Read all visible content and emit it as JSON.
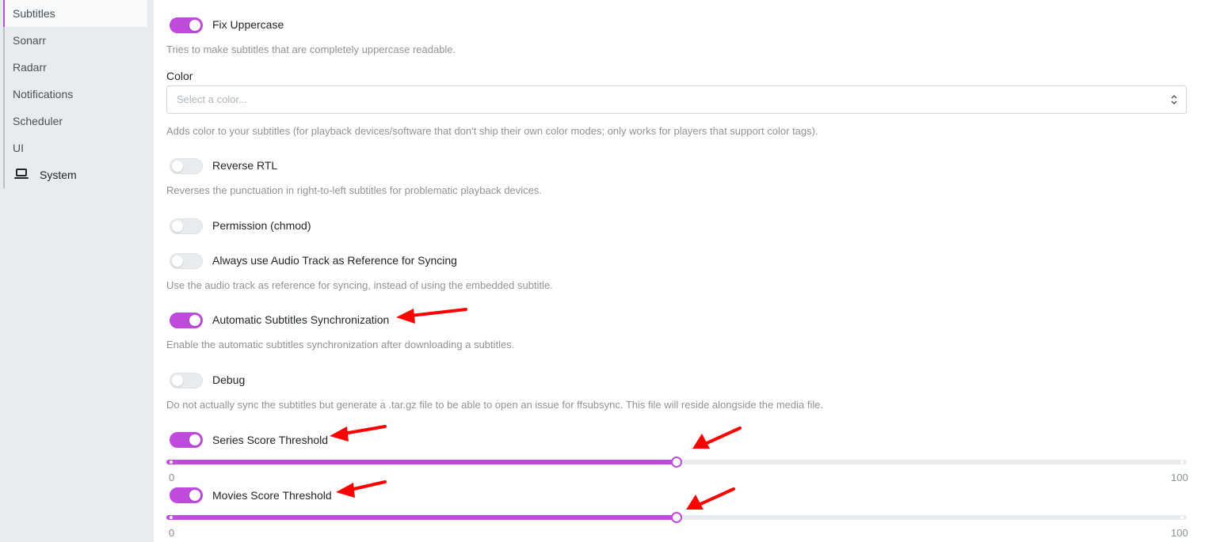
{
  "sidebar": {
    "items": [
      {
        "label": "Subtitles",
        "active": true
      },
      {
        "label": "Sonarr"
      },
      {
        "label": "Radarr"
      },
      {
        "label": "Notifications"
      },
      {
        "label": "Scheduler"
      },
      {
        "label": "UI"
      },
      {
        "label": "System",
        "icon": "laptop-icon"
      }
    ]
  },
  "settings": {
    "fix_uppercase": {
      "label": "Fix Uppercase",
      "enabled": true,
      "description": "Tries to make subtitles that are completely uppercase readable."
    },
    "color": {
      "label": "Color",
      "placeholder": "Select a color...",
      "description": "Adds color to your subtitles (for playback devices/software that don't ship their own color modes; only works for players that support color tags)."
    },
    "reverse_rtl": {
      "label": "Reverse RTL",
      "enabled": false,
      "description": "Reverses the punctuation in right-to-left subtitles for problematic playback devices."
    },
    "permission": {
      "label": "Permission (chmod)",
      "enabled": false
    },
    "audio_track_reference": {
      "label": "Always use Audio Track as Reference for Syncing",
      "enabled": false,
      "description": "Use the audio track as reference for syncing, instead of using the embedded subtitle."
    },
    "auto_sync": {
      "label": "Automatic Subtitles Synchronization",
      "enabled": true,
      "description": "Enable the automatic subtitles synchronization after downloading a subtitles."
    },
    "debug": {
      "label": "Debug",
      "enabled": false,
      "description": "Do not actually sync the subtitles but generate a .tar.gz file to be able to open an issue for ffsubsync. This file will reside alongside the media file."
    },
    "series_threshold": {
      "label": "Series Score Threshold",
      "enabled": true,
      "value": 50,
      "min_label": "0",
      "max_label": "100",
      "min": 0,
      "max": 100
    },
    "movies_threshold": {
      "label": "Movies Score Threshold",
      "enabled": true,
      "value": 50,
      "min_label": "0",
      "max_label": "100",
      "min": 0,
      "max": 100
    }
  },
  "colors": {
    "accent": "#be4bdb",
    "annotation_arrow": "#ff0000"
  }
}
